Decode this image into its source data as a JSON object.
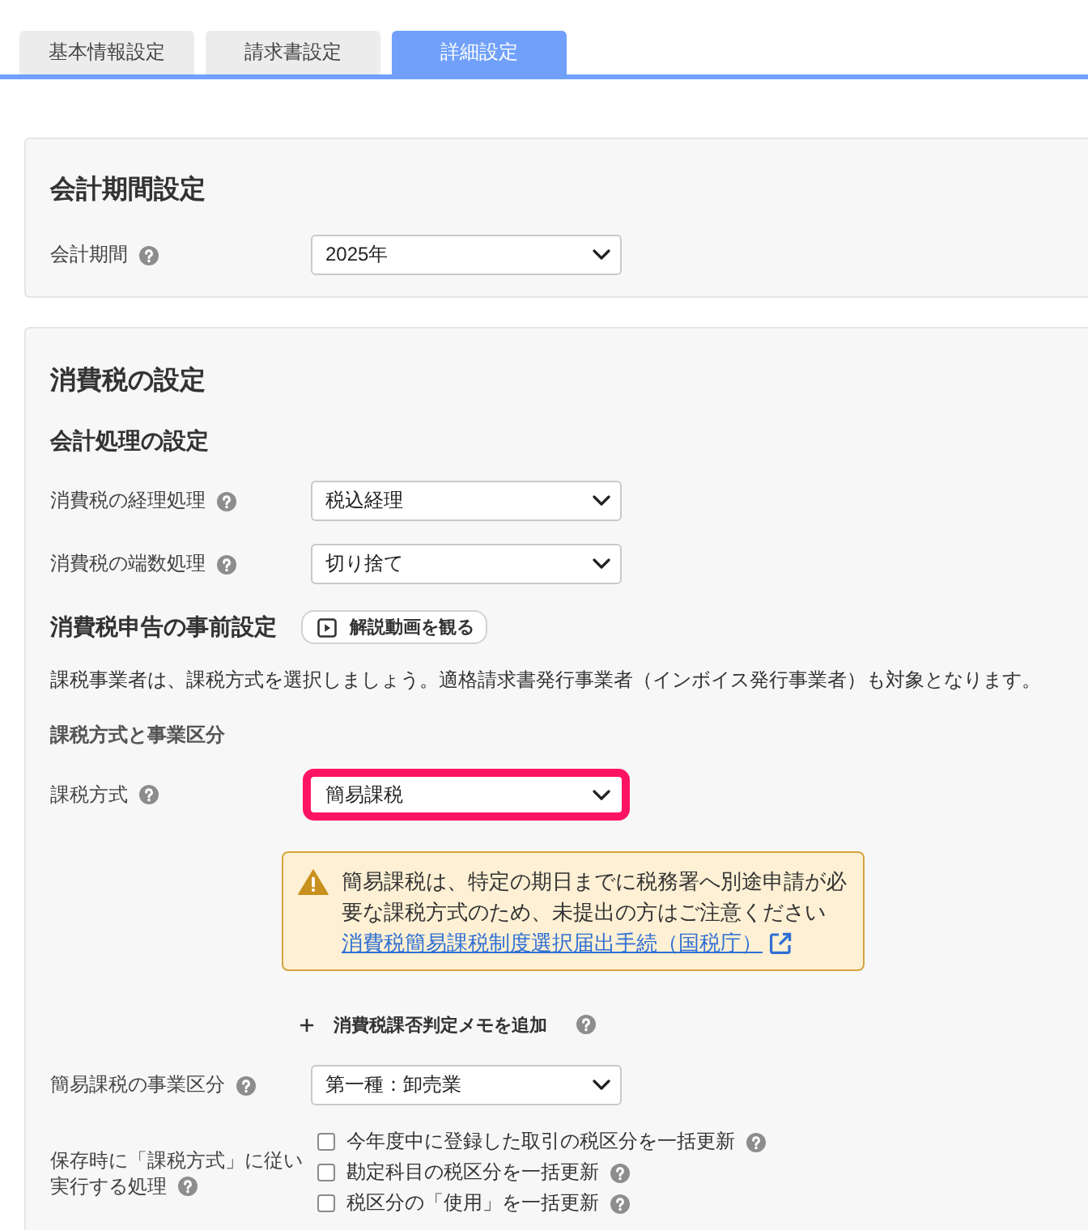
{
  "tabs": [
    {
      "label": "基本情報設定",
      "selected": false
    },
    {
      "label": "請求書設定",
      "selected": false
    },
    {
      "label": "詳細設定",
      "selected": true
    }
  ],
  "accounting_period": {
    "title": "会計期間設定",
    "field": {
      "label": "会計期間",
      "value": "2025年"
    }
  },
  "consumption_tax": {
    "title": "消費税の設定",
    "accounting": {
      "heading": "会計処理の設定",
      "fields": [
        {
          "label": "消費税の経理処理",
          "value": "税込経理"
        },
        {
          "label": "消費税の端数処理",
          "value": "切り捨て"
        }
      ]
    },
    "filing": {
      "heading": "消費税申告の事前設定",
      "video_button": "解説動画を観る",
      "description": "課税事業者は、課税方式を選択しましょう。適格請求書発行事業者（インボイス発行事業者）も対象となります。",
      "group_label": "課税方式と事業区分",
      "tax_method": {
        "label": "課税方式",
        "value": "簡易課税",
        "highlighted": true
      },
      "warning": {
        "text": "簡易課税は、特定の期日までに税務署へ別途申請が必要な課税方式のため、未提出の方はご注意ください",
        "link": "消費税簡易課税制度選択届出手続（国税庁）"
      },
      "add_memo_button": "消費税課否判定メモを追加",
      "business_category": {
        "label": "簡易課税の事業区分",
        "value": "第一種：卸売業"
      },
      "save_actions": {
        "label_lines": [
          "保存時に「課税方式」に従い",
          "実行する処理"
        ],
        "options": [
          {
            "label": "今年度中に登録した取引の税区分を一括更新",
            "checked": false
          },
          {
            "label": "勘定科目の税区分を一括更新",
            "checked": false
          },
          {
            "label": "税区分の「使用」を一括更新",
            "checked": false
          }
        ]
      }
    }
  }
}
